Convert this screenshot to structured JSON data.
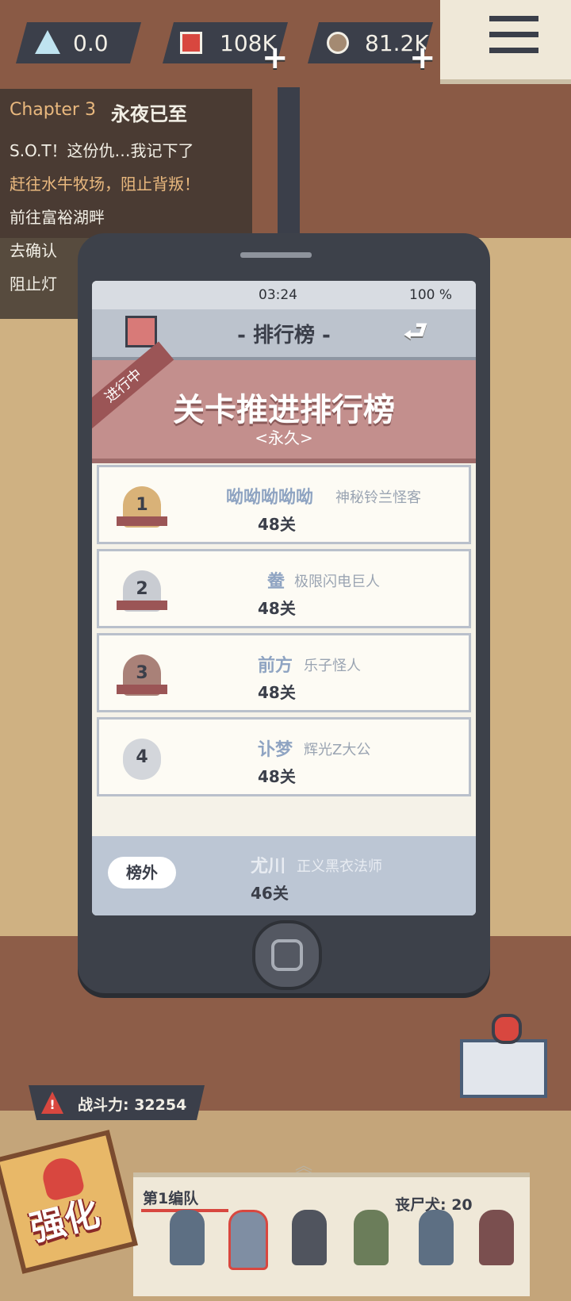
{
  "resources": [
    {
      "icon": "crystal-icon",
      "value": "0.0"
    },
    {
      "icon": "parts-icon",
      "value": "108K",
      "plus": "+"
    },
    {
      "icon": "scrap-icon",
      "value": "81.2K",
      "plus": "+"
    }
  ],
  "quest": {
    "chapter": "Chapter 3",
    "chapter_name": "永夜已至",
    "lines": [
      "S.O.T！这份仇…我记下了",
      "赶往水牛牧场，阻止背叛！",
      "前往富裕湖畔",
      "去确认",
      "阻止灯"
    ]
  },
  "phone": {
    "time": "03:24",
    "battery": "100 %",
    "title": "- 排行榜 -",
    "back_glyph": "⮐",
    "banner": {
      "tag": "进行中",
      "title": "关卡推进排行榜",
      "subtitle": "<永久>"
    },
    "rows": [
      {
        "rank": "1",
        "name": "呦呦呦呦呦",
        "team": "神秘铃兰怪客",
        "level": "48关"
      },
      {
        "rank": "2",
        "name": "鲞",
        "team": "极限闪电巨人",
        "level": "48关"
      },
      {
        "rank": "3",
        "name": "前方",
        "team": "乐子怪人",
        "level": "48关"
      },
      {
        "rank": "4",
        "name": "讣梦",
        "team": "辉光Z大公",
        "level": "48关"
      }
    ],
    "outside": {
      "label": "榜外",
      "name": "尤川",
      "team": "正义黑衣法师",
      "level": "46关"
    }
  },
  "combat_power": {
    "label": "战斗力: 32254",
    "warn": "!"
  },
  "squad": {
    "name": "第1编队",
    "dog_label": "丧尸犬: 20",
    "chevron": "︽"
  },
  "upgrade": {
    "label": "强化"
  },
  "colors": {
    "panel": "#3b3f4a",
    "accent_red": "#d8473f",
    "banner": "#c38f8d",
    "row_bg": "#fdfbf4",
    "name_blue": "#8fa4c2"
  }
}
